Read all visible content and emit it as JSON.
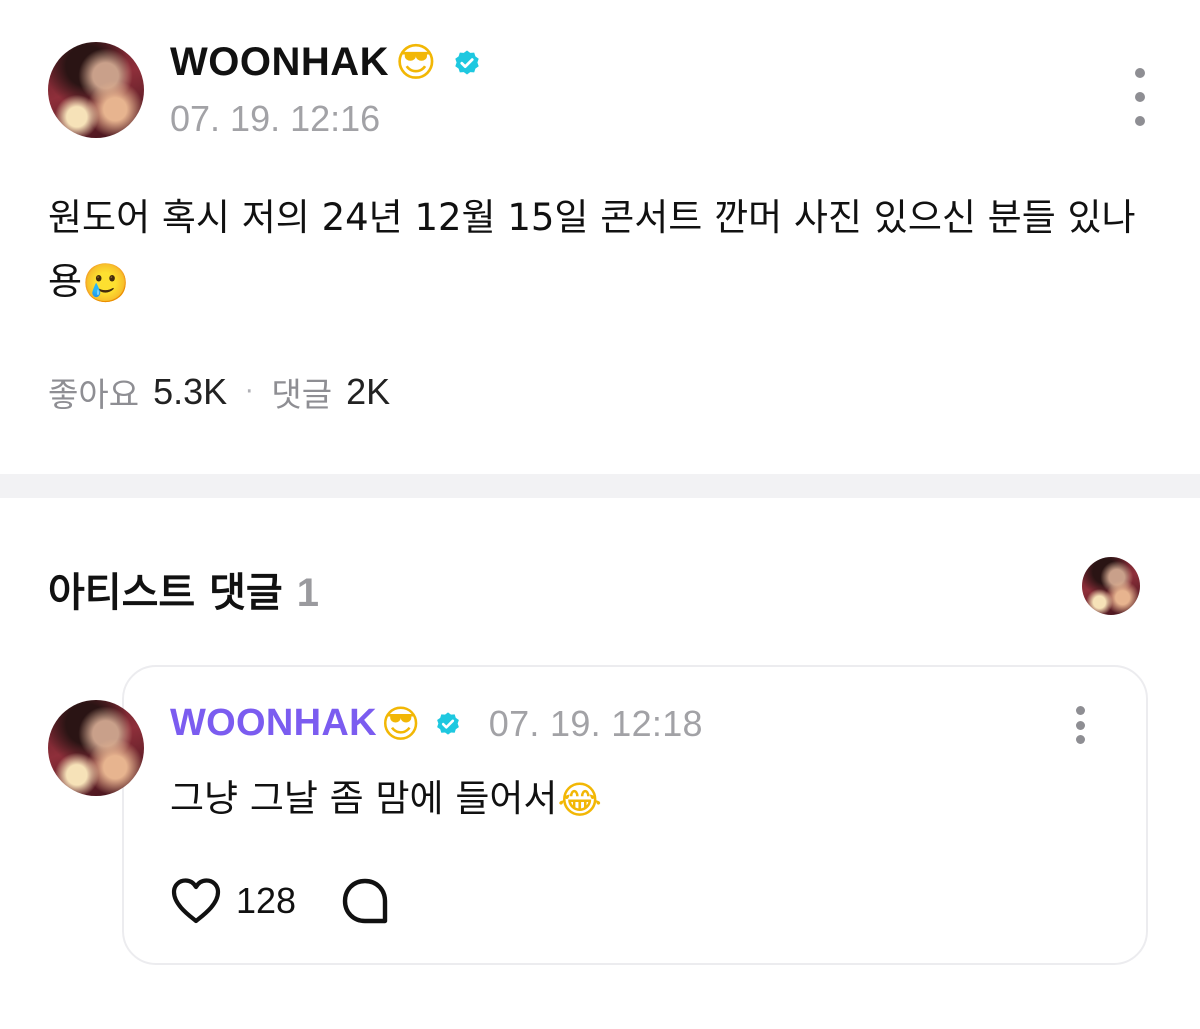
{
  "post": {
    "author": "WOONHAK",
    "author_emoji": "😎",
    "verified": true,
    "timestamp": "07. 19. 12:16",
    "body": "원도어 혹시 저의 24년 12월 15일 콘서트 깐머 사진 있으신 분들 있나용",
    "body_emoji": "🥲",
    "stats": {
      "likes_label": "좋아요",
      "likes_value": "5.3K",
      "separator": "·",
      "comments_label": "댓글",
      "comments_value": "2K"
    }
  },
  "artist_comments": {
    "title": "아티스트 댓글",
    "count": "1",
    "items": [
      {
        "author": "WOONHAK",
        "author_emoji": "😎",
        "verified": true,
        "timestamp": "07. 19. 12:18",
        "text": "그냥 그날 좀 맘에 들어서",
        "text_emoji": "😂",
        "likes": "128"
      }
    ]
  },
  "colors": {
    "verified_badge": "#1ec8e0",
    "artist_name": "#7b5cf0",
    "muted_text": "#a2a2a6",
    "divider": "#f2f2f4"
  },
  "icons": [
    "verified-badge-icon",
    "more-vertical-icon",
    "heart-icon",
    "comment-bubble-icon"
  ]
}
